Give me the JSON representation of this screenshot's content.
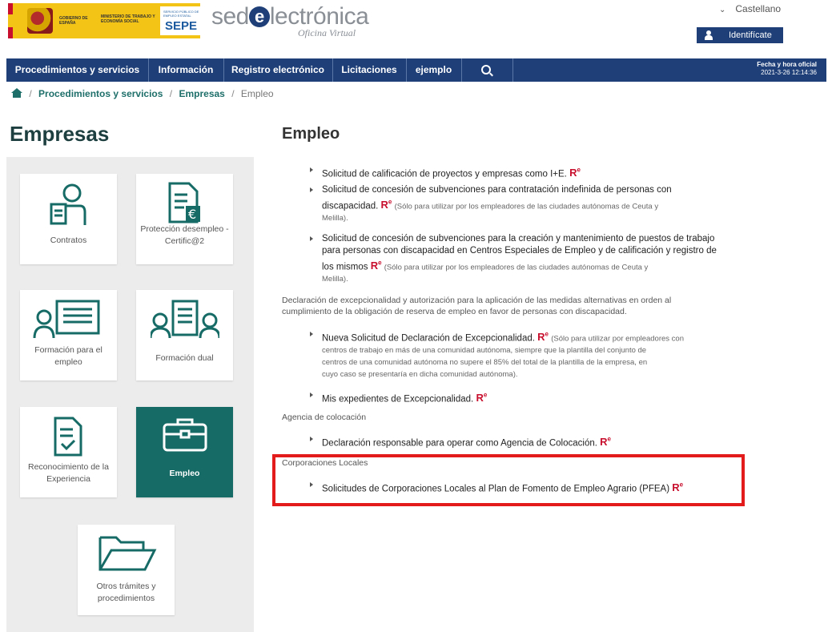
{
  "header": {
    "gov_label": "GOBIERNO DE ESPAÑA",
    "ministry_label": "MINISTERIO DE TRABAJO Y ECONOMÍA SOCIAL",
    "sepe_small": "SERVICIO PÚBLICO DE EMPLEO ESTATAL",
    "sepe_label": "SEPE",
    "sede_pre": "sed",
    "sede_e": "e",
    "sede_post": "lectrónica",
    "sede_sub": "Oficina Virtual",
    "language": "Castellano",
    "identify_label": "Identifícate"
  },
  "nav": {
    "items": [
      "Procedimientos y servicios",
      "Información",
      "Registro electrónico",
      "Licitaciones",
      "ejemplo"
    ],
    "datetime_label": "Fecha y hora oficial",
    "datetime_value": "2021-3-26  12:14:36"
  },
  "breadcrumb": {
    "sep": "/",
    "items": [
      "Procedimientos y servicios",
      "Empresas",
      "Empleo"
    ]
  },
  "sidebar": {
    "title": "Empresas",
    "tiles": [
      {
        "label": "Contratos",
        "icon": "contract-person-icon"
      },
      {
        "label": "Protección desempleo - Certific@2",
        "icon": "euro-document-icon"
      },
      {
        "label": "Formación para el empleo",
        "icon": "training-icon"
      },
      {
        "label": "Formación dual",
        "icon": "dual-training-icon"
      },
      {
        "label": "Reconocimiento de la Experiencia",
        "icon": "checked-document-icon"
      },
      {
        "label": "Empleo",
        "icon": "briefcase-icon",
        "active": true
      },
      {
        "label": "Otros trámites y procedimientos",
        "icon": "folder-icon"
      }
    ]
  },
  "main": {
    "title": "Empleo",
    "re_mark": "R",
    "re_sup": "e",
    "items": [
      {
        "text": "Solicitud de calificación de proyectos y empresas como I+E.",
        "note": ""
      },
      {
        "text_line1": "Solicitud de concesión de subvenciones para contratación indefinida de personas con",
        "text_line2": "discapacidad.",
        "note": "(Sólo para utilizar por los empleadores de las ciudades autónomas de Ceuta y",
        "note2": "Melilla)."
      },
      {
        "text_line1": "Solicitud de concesión de subvenciones para la creación y mantenimiento de puestos de trabajo",
        "text_line2": "para personas con discapacidad en Centros Especiales de Empleo y de calificación y registro de",
        "text_line3": "los mismos",
        "note": "(Sólo para utilizar por los empleadores de las ciudades autónomas de Ceuta y",
        "note2": "Melilla)."
      }
    ],
    "section_exc_line1": "Declaración de excepcionalidad y autorización para la aplicación de las medidas alternativas en orden al",
    "section_exc_line2": "cumplimiento de la obligación de reserva de empleo en favor de personas con discapacidad.",
    "exc_items": [
      {
        "text": "Nueva Solicitud de Declaración de Excepcionalidad.",
        "note1": "(Sólo para utilizar por empleadores con",
        "note2": "centros de trabajo en más de una comunidad autónoma, siempre que la plantilla del conjunto de",
        "note3": "centros de una comunidad autónoma no supere el 85% del total de la plantilla de la empresa, en",
        "note4": "cuyo caso se presentaría en dicha comunidad autónoma)."
      },
      {
        "text": "Mis expedientes de Excepcionalidad."
      }
    ],
    "section_agency": "Agencia de colocación",
    "agency_item": "Declaración responsable para operar como Agencia de Colocación.",
    "section_local": "Corporaciones Locales",
    "local_item": "Solicitudes de Corporaciones Locales al Plan de Fomento de Empleo Agrario (PFEA)"
  },
  "colors": {
    "nav_bg": "#1e3f78",
    "teal": "#176b66",
    "re_red": "#c8102e",
    "highlight_red": "#e31b1b"
  }
}
